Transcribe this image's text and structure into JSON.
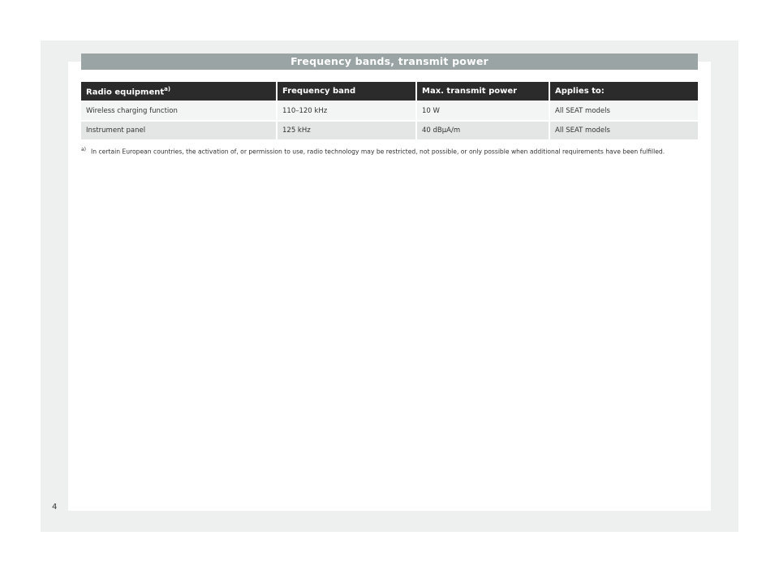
{
  "section_title": "Frequency bands, transmit power",
  "table": {
    "headers": {
      "col1": "Radio equipment",
      "col1_note": "a)",
      "col2": "Frequency band",
      "col3": "Max. transmit power",
      "col4": "Applies to:"
    },
    "rows": [
      {
        "equipment": "Wireless charging function",
        "band": "110–120 kHz",
        "power": "10 W",
        "applies": "All SEAT models"
      },
      {
        "equipment": "Instrument panel",
        "band": "125 kHz",
        "power": "40 dBµA/m",
        "applies": "All SEAT models"
      }
    ]
  },
  "footnote": {
    "marker": "a)",
    "text": "In certain European countries, the activation of, or permission to use, radio technology may be restricted, not possible, or only possible when additional requirements have been fulfilled."
  },
  "page_number": "4"
}
